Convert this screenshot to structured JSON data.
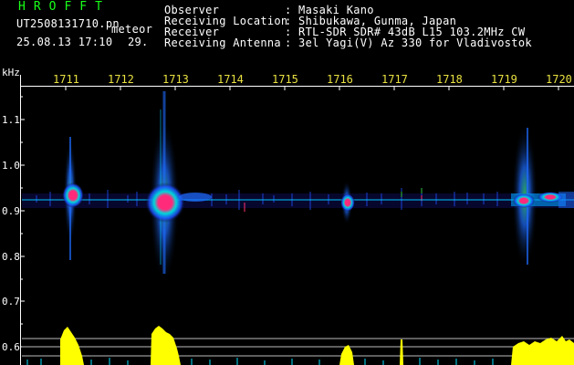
{
  "header": {
    "program": "HROFFT",
    "filename": "UT2508131710.pn",
    "tag": "meteor",
    "datetime": "25.08.13 17:10",
    "number": "29.",
    "fields": [
      {
        "label": "Observer",
        "value": ": Masaki Kano"
      },
      {
        "label": "Receiving Location",
        "value": ": Shibukawa, Gunma, Japan"
      },
      {
        "label": "Receiver",
        "value": ": RTL-SDR SDR# 43dB L15 103.2MHz CW"
      },
      {
        "label": "Receiving Antenna",
        "value": ": 3el Yagi(V) Az 330 for Vladivostok"
      }
    ]
  },
  "time_axis": {
    "labels": [
      "1711",
      "1712",
      "1713",
      "1714",
      "1715",
      "1716",
      "1717",
      "1718",
      "1719",
      "1720"
    ]
  },
  "freq_axis": {
    "unit": "kHz",
    "labels": [
      "1.1",
      "1.0",
      "0.9",
      "0.8",
      "0.7",
      "0.6"
    ]
  },
  "colors": {
    "header_accent": "#19ff19",
    "tick_labels": "#e8e040",
    "signal_hot": "#ff2a7a",
    "signal_mid": "#1e6cff",
    "signal_low": "#00e0ff",
    "bar_yellow": "#ffff00"
  }
}
